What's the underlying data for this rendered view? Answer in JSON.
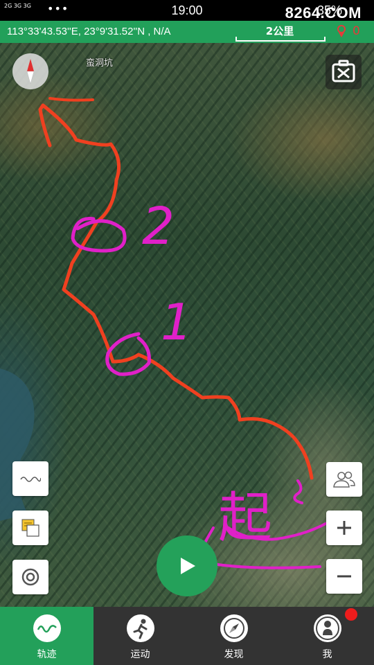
{
  "status_bar": {
    "signal": "2G 3G 3G",
    "dots": "•••",
    "time": "19:00",
    "battery": "35%"
  },
  "watermark": "8264.COM",
  "coord_bar": {
    "coordinates": "113°33'43.53''E, 23°9'31.52''N , N/A",
    "scale": "2公里",
    "gps_count": "0"
  },
  "map": {
    "place_label": "蛮洞坑",
    "annotations": {
      "start": "起",
      "marker_1": "1",
      "marker_2": "2"
    }
  },
  "controls": {
    "compass": "compass-icon",
    "tools": "tools-icon",
    "track_style": "wave-icon",
    "layers": "layers-icon",
    "locate": "locate-icon",
    "group": "group-icon",
    "zoom_in": "plus-icon",
    "zoom_out": "minus-icon",
    "start": "play-icon"
  },
  "colors": {
    "accent": "#23a05a",
    "route": "#f04020",
    "marker": "#e020c8",
    "badge": "#ee1c1c"
  },
  "nav": {
    "items": [
      {
        "label": "轨迹",
        "icon": "track-icon",
        "active": true
      },
      {
        "label": "运动",
        "icon": "sport-icon",
        "active": false
      },
      {
        "label": "发现",
        "icon": "discover-icon",
        "active": false
      },
      {
        "label": "我",
        "icon": "profile-icon",
        "active": false
      }
    ]
  }
}
